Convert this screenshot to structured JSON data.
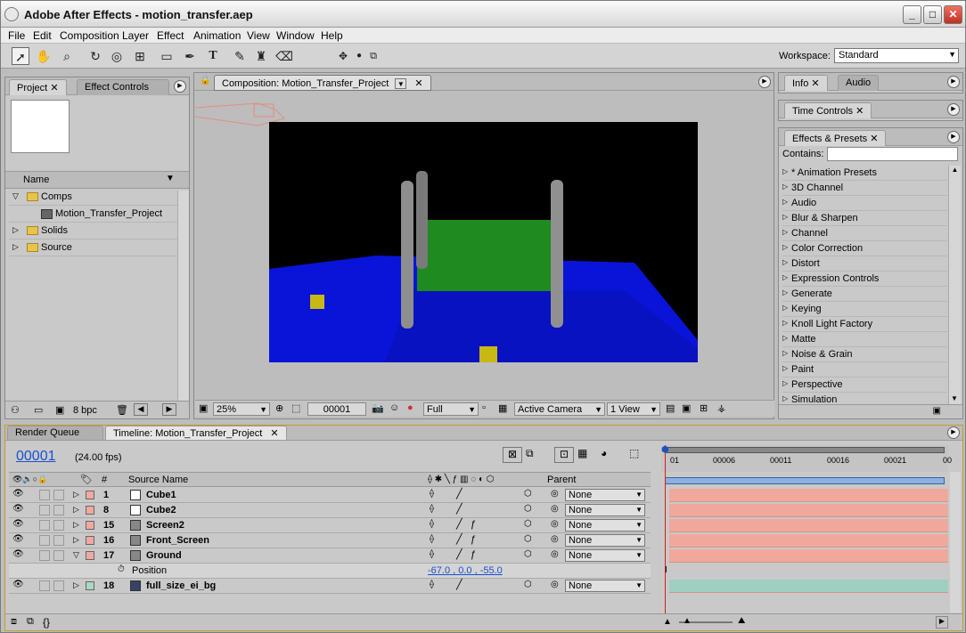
{
  "window": {
    "title": "Adobe After Effects - motion_transfer.aep",
    "controls": [
      "_",
      "□",
      "✕"
    ]
  },
  "menu": [
    "File",
    "Edit",
    "Composition",
    "Layer",
    "Effect",
    "Animation",
    "View",
    "Window",
    "Help"
  ],
  "toolbar": {
    "workspace_label": "Workspace:",
    "workspace_value": "Standard",
    "tools": [
      "selection-tool-icon",
      "hand-tool-icon",
      "zoom-tool-icon",
      "rotate-tool-icon",
      "orbit-camera-icon",
      "track-camera-icon",
      "rectangle-mask-icon",
      "pen-tool-icon",
      "type-tool-icon",
      "brush-tool-icon",
      "clone-stamp-icon",
      "eraser-icon",
      "axis-icon"
    ]
  },
  "project_panel": {
    "tabs": [
      "Project",
      "Effect Controls"
    ],
    "column_header": "Name",
    "items": [
      {
        "label": "Comps",
        "type": "folder",
        "expanded": true
      },
      {
        "label": "Motion_Transfer_Project",
        "type": "comp",
        "indent": true
      },
      {
        "label": "Solids",
        "type": "folder",
        "expanded": false
      },
      {
        "label": "Source",
        "type": "folder",
        "expanded": false
      }
    ],
    "bpc": "8 bpc"
  },
  "comp_panel": {
    "tab": "Composition: Motion_Transfer_Project",
    "zoom": "25%",
    "timecode": "00001",
    "resolution": "Full",
    "camera": "Active Camera",
    "views": "1 View"
  },
  "info_panel": {
    "tabs": [
      "Info",
      "Audio"
    ]
  },
  "time_controls": {
    "tab": "Time Controls"
  },
  "effects_panel": {
    "tab": "Effects & Presets",
    "contains_label": "Contains:",
    "categories": [
      "* Animation Presets",
      "3D Channel",
      "Audio",
      "Blur & Sharpen",
      "Channel",
      "Color Correction",
      "Distort",
      "Expression Controls",
      "Generate",
      "Keying",
      "Knoll Light Factory",
      "Matte",
      "Noise & Grain",
      "Paint",
      "Perspective",
      "Simulation"
    ]
  },
  "timeline": {
    "tabs": [
      "Render Queue",
      "Timeline: Motion_Transfer_Project"
    ],
    "current_time": "00001",
    "fps": "(24.00 fps)",
    "col_num": "#",
    "col_source": "Source Name",
    "col_parent": "Parent",
    "ruler": [
      "01",
      "00006",
      "00011",
      "00016",
      "00021",
      "00"
    ],
    "layers": [
      {
        "num": "1",
        "name": "Cube1",
        "label_color": "#f0a8a0",
        "swatch": "#ffffff",
        "bar": "#f0a89c",
        "parent": "None"
      },
      {
        "num": "8",
        "name": "Cube2",
        "label_color": "#f0a8a0",
        "swatch": "#ffffff",
        "bar": "#f0a89c",
        "parent": "None"
      },
      {
        "num": "15",
        "name": "Screen2",
        "label_color": "#f0a8a0",
        "swatch": "#888888",
        "bar": "#f0a89c",
        "parent": "None"
      },
      {
        "num": "16",
        "name": "Front_Screen",
        "label_color": "#f0a8a0",
        "swatch": "#888888",
        "bar": "#f0a89c",
        "parent": "None"
      },
      {
        "num": "17",
        "name": "Ground",
        "label_color": "#f0a8a0",
        "swatch": "#888888",
        "bar": "#f0a89c",
        "parent": "None"
      },
      {
        "num": "18",
        "name": "full_size_ei_bg",
        "label_color": "#a8d8c0",
        "swatch": "#334466",
        "bar": "#9fcfc0",
        "parent": "None"
      }
    ],
    "position_label": "Position",
    "position_value": "-67.0 , 0.0 , -55.0"
  },
  "colors": {
    "accent": "#1a4fd0",
    "ground": "#0a14d8",
    "screen": "#1f8a1f",
    "cube": "#c8b814"
  }
}
